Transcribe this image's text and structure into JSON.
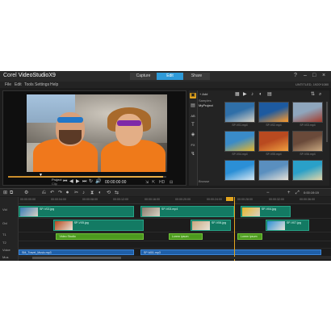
{
  "app": {
    "brand": "Corel",
    "product": "VideoStudioX9",
    "window_controls": {
      "help": "?",
      "minimize": "–",
      "maximize": "□",
      "close": "×"
    }
  },
  "modes": [
    {
      "label": "Capture",
      "active": false
    },
    {
      "label": "Edit",
      "active": true
    },
    {
      "label": "Share",
      "active": false
    }
  ],
  "menu": {
    "items": [
      "File",
      "Edit",
      "Tools",
      "Settings",
      "Help"
    ],
    "right_text": "UNTITLED, 1920*1080"
  },
  "player": {
    "playhead_marker": "▼",
    "project_label": "Project",
    "clip_label": "Clip",
    "progress": 0.98,
    "transport": [
      "⏮",
      "◀",
      "▶",
      "⏭",
      "↻",
      "🔊"
    ],
    "timecode": "00:00:00:00",
    "right_controls": [
      "⇲",
      "⇱",
      "HD",
      "⊟"
    ]
  },
  "tools": {
    "items": [
      {
        "icon": "media-icon",
        "glyph": "▣",
        "active": true
      },
      {
        "icon": "instant-project-icon",
        "glyph": "▤",
        "active": false
      },
      {
        "icon": "transition-icon",
        "glyph": "AB",
        "active": false
      },
      {
        "icon": "title-icon",
        "glyph": "T",
        "active": false
      },
      {
        "icon": "graphics-icon",
        "glyph": "◈",
        "active": false
      },
      {
        "icon": "filter-icon",
        "glyph": "FX",
        "active": false
      },
      {
        "icon": "path-icon",
        "glyph": "↯",
        "active": false
      }
    ]
  },
  "library": {
    "toolbar": {
      "add_label": "+ Add",
      "view_icons": [
        "▦",
        "▶",
        "♪",
        "◐",
        "▤"
      ],
      "sort": "⇅",
      "search": "⌕"
    },
    "folders": [
      {
        "label": "Samples",
        "selected": false
      },
      {
        "label": "MyProject",
        "selected": true
      }
    ],
    "thumbnails": [
      {
        "caption": "SP-V01.mp4",
        "color1": "#2f6fa8",
        "color2": "#d8d1c3"
      },
      {
        "caption": "SP-V02.mp4",
        "color1": "#1d5aa0",
        "color2": "#ff9b2a"
      },
      {
        "caption": "SP-V03.mp4",
        "color1": "#8fa6bd",
        "color2": "#a33a2a"
      },
      {
        "caption": "SP-V04.mp4",
        "color1": "#3a8bc8",
        "color2": "#e6b72c"
      },
      {
        "caption": "SP-V05.mp4",
        "color1": "#b94a20",
        "color2": "#f0a040"
      },
      {
        "caption": "SP-V06.mp4",
        "color1": "#6a4a3a",
        "color2": "#c9a880"
      },
      {
        "caption": "SP-V07.mp4",
        "color1": "#2b8fd6",
        "color2": "#d9e8f2"
      },
      {
        "caption": "SP-V08.mp4",
        "color1": "#5a8fbf",
        "color2": "#e7e2d8"
      },
      {
        "caption": "SP-V09.mp4",
        "color1": "#2aa0c8",
        "color2": "#e5d7a8"
      }
    ],
    "browse_label": "Browse"
  },
  "timeline": {
    "toolbar_left": [
      "⊞",
      "⧉",
      "⚙",
      "⎌",
      "↶",
      "↷",
      "⏺",
      "✂",
      "♪",
      "⧗",
      "◐",
      "⟲",
      "⇆"
    ],
    "toolbar_right": [
      "−",
      "+",
      "⤢",
      "0:00:19:19"
    ],
    "ruler": [
      "00:00:00:00",
      "00:00:04:00",
      "00:00:08:00",
      "00:00:12:00",
      "00:00:16:00",
      "00:00:20:00",
      "00:00:24:00",
      "00:00:28:00",
      "00:00:32:00",
      "00:00:36:00"
    ],
    "tracks": [
      "Vid",
      "Ovl",
      "T1",
      "T2",
      "Voice",
      "Mus"
    ],
    "video_clips": [
      {
        "label": "SP-V02.jpg",
        "start": 0.0,
        "end": 0.37,
        "thumb": "#3a7db8"
      },
      {
        "label": "SP-V03.mp4",
        "start": 0.39,
        "end": 0.69,
        "thumb": "#8b7f70"
      },
      {
        "label": "SP-V04.jpg",
        "start": 0.71,
        "end": 0.87,
        "thumb": "#e6b72c"
      }
    ],
    "overlay_clips": [
      {
        "label": "SP-V05.jpg",
        "start": 0.11,
        "end": 0.4,
        "thumb": "#b94a20"
      },
      {
        "label": "SP-V06.jpg",
        "start": 0.55,
        "end": 0.68,
        "thumb": "#c9a880"
      },
      {
        "label": "SP-V07.jpg",
        "start": 0.79,
        "end": 0.93,
        "thumb": "#2b8fd6"
      }
    ],
    "title_clips": [
      {
        "label": "Video Studio",
        "start": 0.12,
        "end": 0.4
      },
      {
        "label": "Lorem ipsum",
        "start": 0.48,
        "end": 0.59
      },
      {
        "label": "Lorem ipsum",
        "start": 0.7,
        "end": 0.78
      }
    ],
    "music_clips": [
      {
        "label": "SM_Travel_Music.mp3",
        "start": 0.0,
        "end": 0.37
      },
      {
        "label": "SP-M01.mp3",
        "start": 0.39,
        "end": 0.97
      }
    ],
    "playhead": 0.69
  }
}
